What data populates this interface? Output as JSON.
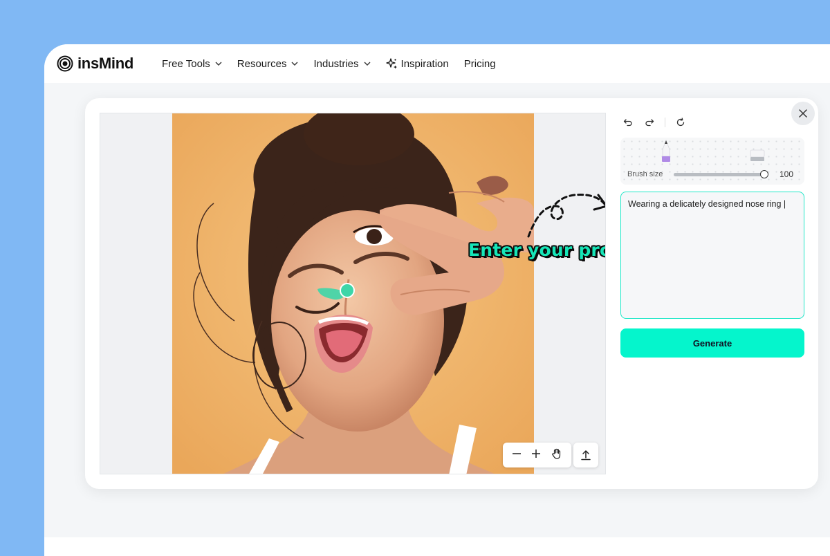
{
  "brand": {
    "name": "insMind"
  },
  "nav": {
    "items": [
      {
        "label": "Free Tools",
        "dropdown": true
      },
      {
        "label": "Resources",
        "dropdown": true
      },
      {
        "label": "Industries",
        "dropdown": true
      },
      {
        "label": "Inspiration",
        "icon": "sparkle-icon"
      },
      {
        "label": "Pricing"
      }
    ]
  },
  "editor": {
    "callout_text": "Enter your prompt",
    "brush": {
      "label": "Brush size",
      "value": "100",
      "level_fraction": 1.0
    },
    "prompt": {
      "value": "Wearing a delicately designed nose ring |"
    },
    "generate_label": "Generate",
    "toolbar_icons": [
      "undo-icon",
      "redo-icon",
      "reset-icon"
    ],
    "zoom_icons": [
      "zoom-out-icon",
      "zoom-in-icon",
      "hand-pan-icon",
      "upload-icon"
    ]
  },
  "colors": {
    "page_bg": "#80b8f4",
    "accent": "#05f5cc",
    "mask": "#3dd6a8",
    "photo_bg": "#f0b66a"
  }
}
